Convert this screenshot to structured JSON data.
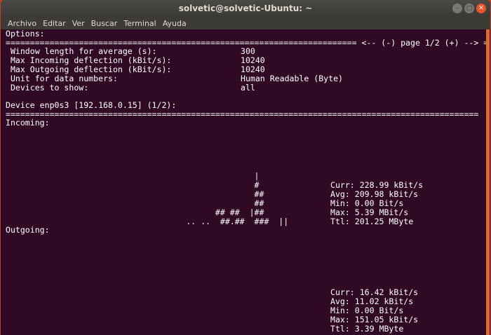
{
  "window": {
    "title": "solvetic@solvetic-Ubuntu: ~"
  },
  "menu": [
    "Archivo",
    "Editar",
    "Ver",
    "Buscar",
    "Terminal",
    "Ayuda"
  ],
  "options": {
    "heading": "Options:",
    "pager": "======================================================================== <-- (-) page 1/2 (+) --> =",
    "rows": [
      {
        "label": " Window length for average (s):",
        "value": "300"
      },
      {
        "label": " Max Incoming deflection (kBit/s):",
        "value": "10240"
      },
      {
        "label": " Max Outgoing deflection (kBit/s):",
        "value": "10240"
      },
      {
        "label": " Unit for data numbers:",
        "value": "Human Readable (Byte)"
      },
      {
        "label": " Devices to show:",
        "value": "all"
      }
    ]
  },
  "device": {
    "line": "Device enp0s3 [192.168.0.15] (1/2):",
    "separator": "================================================================================================="
  },
  "incoming": {
    "label": "Incoming:",
    "graph": [
      "                                                   |",
      "                                                   #",
      "                                                   ##",
      "                                                   ##",
      "                                           ## ##  |##",
      "                                     .. ..  ##.##  ###  ||"
    ],
    "stats": [
      "Curr: 228.99 kBit/s",
      "Avg: 209.98 kBit/s",
      "Min: 0.00 Bit/s",
      "Max: 5.39 MBit/s",
      "Ttl: 201.25 MByte"
    ]
  },
  "outgoing": {
    "label": "Outgoing:",
    "stats": [
      "Curr: 16.42 kBit/s",
      "Avg: 11.02 kBit/s",
      "Min: 0.00 Bit/s",
      "Max: 151.05 kBit/s",
      "Ttl: 3.39 MByte"
    ]
  }
}
